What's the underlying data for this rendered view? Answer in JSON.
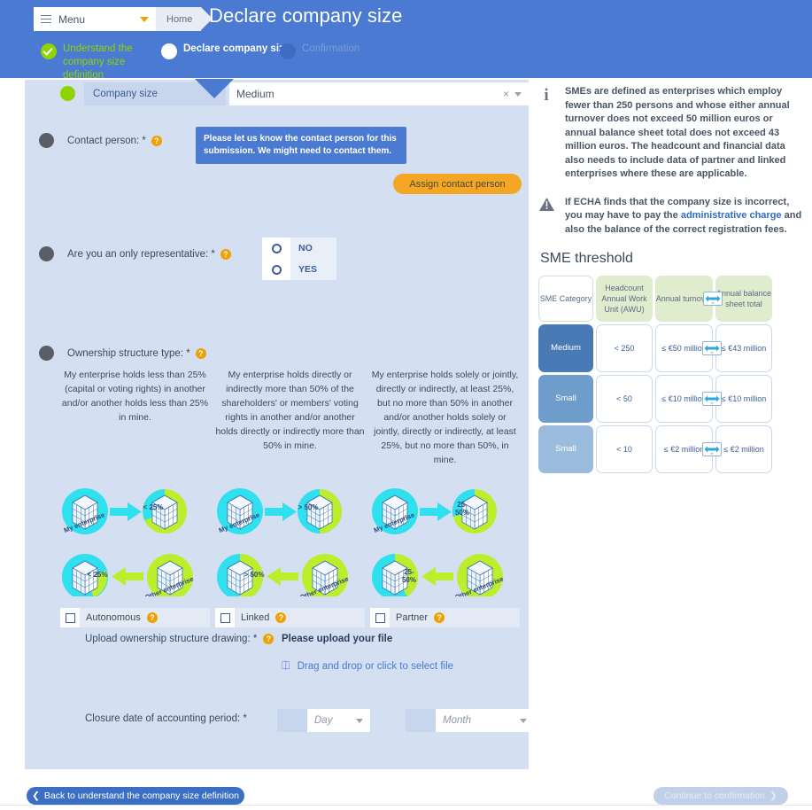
{
  "header": {
    "menu_label": "Menu",
    "breadcrumb_home": "Home",
    "page_title": "Declare company size",
    "steps": [
      {
        "label": "Understand the company size definition",
        "state": "done"
      },
      {
        "label": "Declare company size",
        "state": "current"
      },
      {
        "label": "Confirmation",
        "state": "future"
      }
    ]
  },
  "form": {
    "company_size": {
      "label": "Company size",
      "value": "Medium",
      "clear_icon": "×"
    },
    "contact_person": {
      "label": "Contact person: *",
      "tooltip": "Please let us know the contact person for this submission. We might need to contact them.",
      "button": "Assign contact person"
    },
    "only_representative": {
      "label": "Are you an only representative: *",
      "options": [
        "NO",
        "YES"
      ]
    },
    "ownership": {
      "label": "Ownership structure type: *",
      "descriptions": [
        "My enterprise holds less than 25% (capital or voting rights) in another and/or another holds less than 25% in mine.",
        "My enterprise holds directly or indirectly more than 50% of the shareholders' or members' voting rights in another and/or another holds directly or indirectly more than 50% in mine.",
        "My enterprise holds solely or jointly, directly or indirectly, at least 25%, but no more than 50% in another and/or another holds solely or jointly, directly or indirectly, at least 25%, but no more than 50%, in mine."
      ],
      "diagrams": [
        {
          "top_badge": "< 25%",
          "bottom_badge": "< 25%",
          "my": "My enterprise",
          "other": "Other enterprise"
        },
        {
          "top_badge": "> 50%",
          "bottom_badge": "> 50%",
          "my": "My enterprise",
          "other": "Other enterprise"
        },
        {
          "top_badge": "25-50%",
          "bottom_badge": "25-50%",
          "my": "My enterprise",
          "other": "Other enterprise"
        }
      ],
      "checkboxes": [
        "Autonomous",
        "Linked",
        "Partner"
      ]
    },
    "upload": {
      "label": "Upload ownership structure drawing: *",
      "title": "Please upload your file",
      "drop_text": "Drag and drop or click to select file"
    },
    "closure_date": {
      "label": "Closure date of accounting period: *",
      "day_placeholder": "Day",
      "month_placeholder": "Month"
    }
  },
  "right_panel": {
    "info_note": "SMEs are defined as enterprises which employ fewer than 250 persons and whose either annual turnover does not exceed 50 million euros or annual balance sheet total does not exceed 43 million euros. The headcount and financial data also needs to include data of partner and linked enterprises where these are applicable.",
    "warning_note_pre": "If ECHA finds that the company size is incorrect, you may have to pay the ",
    "warning_note_link": "administrative charge",
    "warning_note_post": " and also the balance of the correct registration fees.",
    "sme_title": "SME threshold",
    "sme_table": {
      "headers": [
        "SME Category",
        "Headcount Annual Work Unit (AWU)",
        "Annual turnover",
        "Annual balance sheet total"
      ],
      "or_label": "or",
      "rows": [
        {
          "category": "Medium",
          "awu": "< 250",
          "turnover": "≤ €50 million",
          "balance": "≤ €43 million"
        },
        {
          "category": "Small",
          "awu": "< 50",
          "turnover": "≤ €10 million",
          "balance": "≤ €10 million"
        },
        {
          "category": "Small",
          "awu": "< 10",
          "turnover": "≤ €2 million",
          "balance": "≤ €2 million"
        }
      ]
    }
  },
  "footer": {
    "back_button": "Back to understand the company size definition",
    "continue_button": "Continue to confirmation",
    "back_chevron": "❮",
    "continue_chevron": "❯"
  },
  "colors": {
    "header_blue": "#4a7ad1",
    "panel_blue": "#d4dff2",
    "accent_orange": "#f5a623",
    "step_green": "#8fd400",
    "cyan": "#2fe0ee",
    "lime": "#bdee2c"
  }
}
